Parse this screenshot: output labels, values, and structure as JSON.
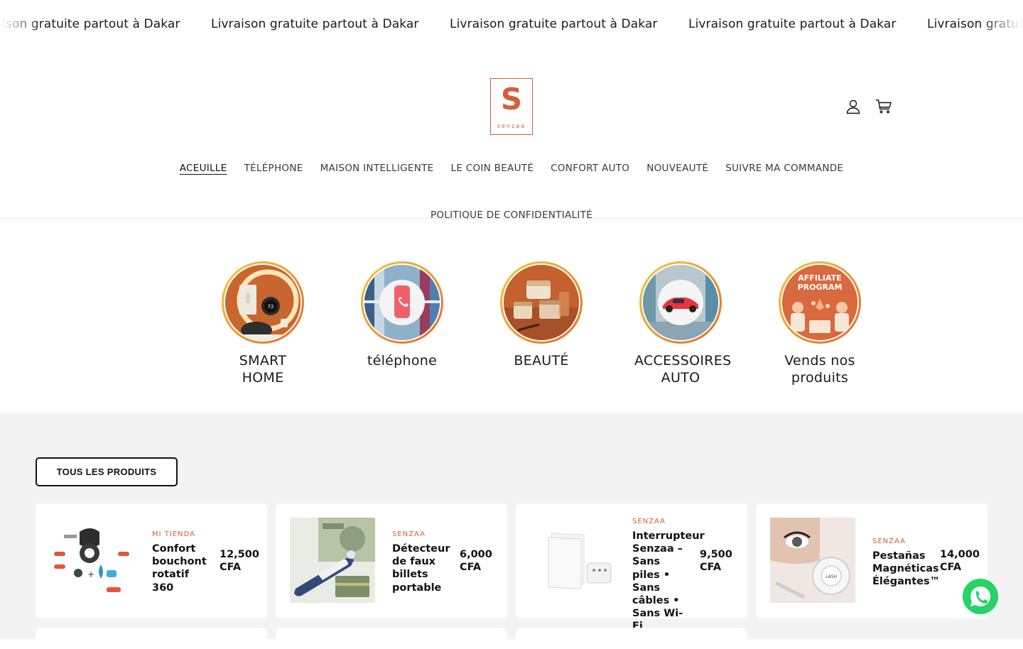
{
  "announcement": {
    "items": [
      "Livraison gratuite partout à Dakar",
      "Livraison gratuite partout à Dakar",
      "Livraison gratuite partout à Dakar",
      "Livraison gratuite partout à Dakar",
      "Livraison gratuite partout à Dakar"
    ]
  },
  "header": {
    "logo_letter": "S",
    "logo_word": "senzaa",
    "account_icon": "account-icon",
    "cart_icon": "cart-icon"
  },
  "nav": {
    "items": [
      "ACEUILLE",
      "TÉLÉPHONE",
      "MAISON INTELLIGENTE",
      "LE COIN BEAUTÉ",
      "CONFORT AUTO",
      "NOUVEAUTÉ",
      "SUIVRE MA COMMANDE",
      "POLITIQUE DE CONFIDENTIALITÉ"
    ],
    "active": "ACEUILLE"
  },
  "categories": [
    {
      "label": "SMART HOME"
    },
    {
      "label": "téléphone"
    },
    {
      "label": "BEAUTÉ"
    },
    {
      "label": "ACCESSOIRES AUTO"
    },
    {
      "label": "Vends nos produits"
    }
  ],
  "affiliate_badge": {
    "line1": "AFFILIATE",
    "line2": "PROGRAM"
  },
  "products": {
    "all_button": "TOUS LES PRODUITS",
    "items": [
      {
        "vendor": "MI TIENDA",
        "title": "Confort bouchont rotatif 360",
        "price": "12,500 CFA"
      },
      {
        "vendor": "SENZAA",
        "title": "Détecteur de faux billets portable",
        "price": "6,000 CFA"
      },
      {
        "vendor": "SENZAA",
        "title": "Interrupteur Senzaa – Sans piles • Sans câbles • Sans Wi-Fi",
        "price": "9,500 CFA"
      },
      {
        "vendor": "SENZAA",
        "title": "Pestañas Magnéticas Élégantes™",
        "price": "14,000 CFA"
      }
    ]
  },
  "colors": {
    "brand": "#d35f3b",
    "whatsapp": "#25d366",
    "ring_start": "#f3cf3a",
    "ring_end": "#e3662d"
  }
}
